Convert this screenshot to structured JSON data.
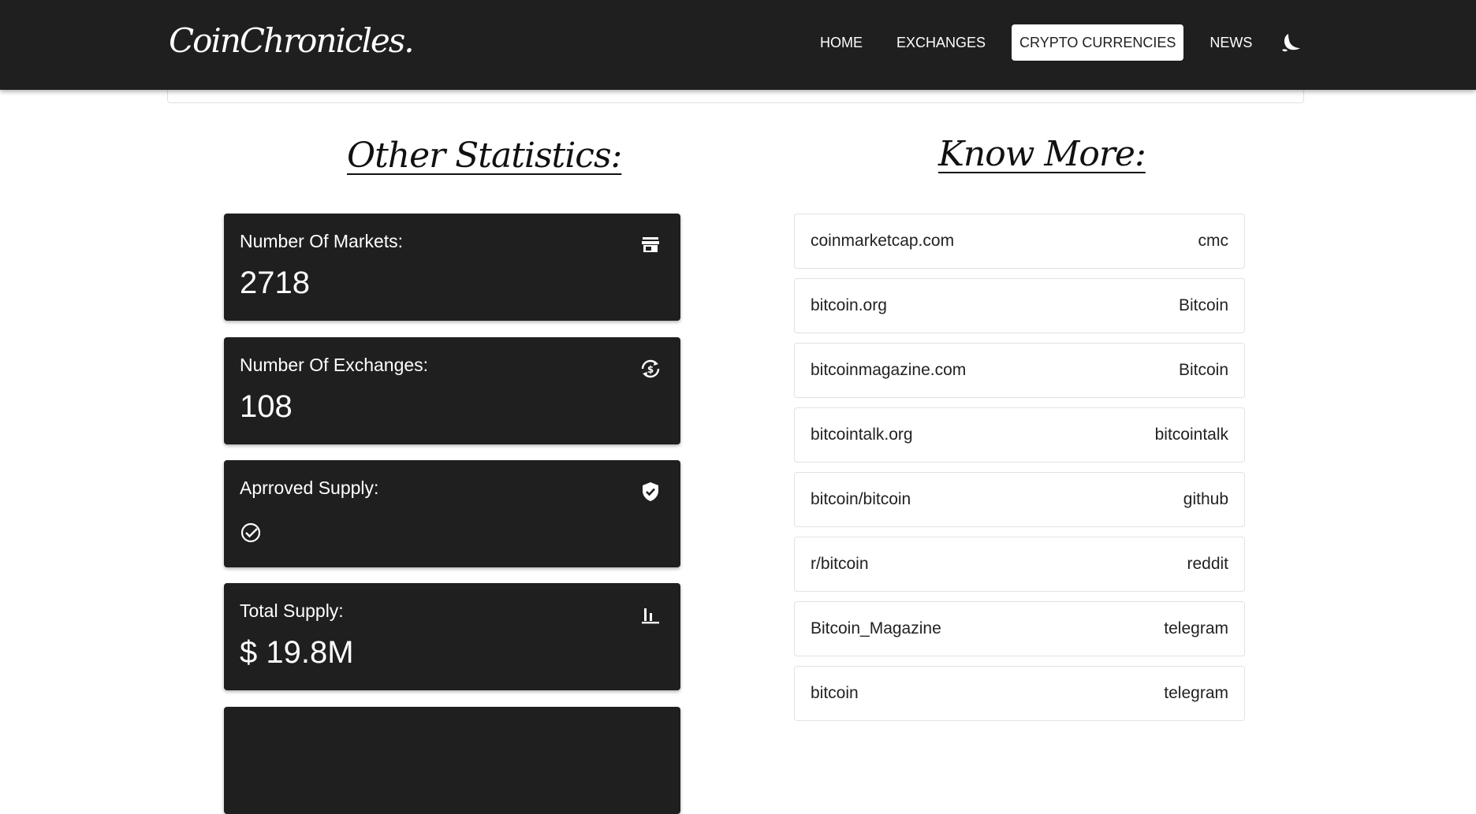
{
  "header": {
    "logo": "CoinChronicles.",
    "nav": [
      {
        "label": "HOME",
        "active": false
      },
      {
        "label": "EXCHANGES",
        "active": false
      },
      {
        "label": "CRYPTO CURRENCIES",
        "active": true
      },
      {
        "label": "NEWS",
        "active": false
      }
    ],
    "theme_toggle_icon": "moon-icon"
  },
  "statistics": {
    "title": "Other Statistics:",
    "cards": [
      {
        "label": "Number Of Markets:",
        "value": "2718",
        "icon": "store-icon"
      },
      {
        "label": "Number Of Exchanges:",
        "value": "108",
        "icon": "currency-exchange-icon"
      },
      {
        "label": "Aprroved Supply:",
        "value": "",
        "icon": "shield-check-icon",
        "value_icon": "check-circle-icon"
      },
      {
        "label": "Total Supply:",
        "value": "$ 19.8M",
        "icon": "bar-chart-icon"
      }
    ]
  },
  "links": {
    "title": "Know More:",
    "items": [
      {
        "name": "coinmarketcap.com",
        "type": "cmc"
      },
      {
        "name": "bitcoin.org",
        "type": "Bitcoin"
      },
      {
        "name": "bitcoinmagazine.com",
        "type": "Bitcoin"
      },
      {
        "name": "bitcointalk.org",
        "type": "bitcointalk"
      },
      {
        "name": "bitcoin/bitcoin",
        "type": "github"
      },
      {
        "name": "r/bitcoin",
        "type": "reddit"
      },
      {
        "name": "Bitcoin_Magazine",
        "type": "telegram"
      },
      {
        "name": "bitcoin",
        "type": "telegram"
      }
    ]
  },
  "colors": {
    "bar": "#1f1f1f",
    "card": "#1f1f1f",
    "text": "#ffffff"
  }
}
